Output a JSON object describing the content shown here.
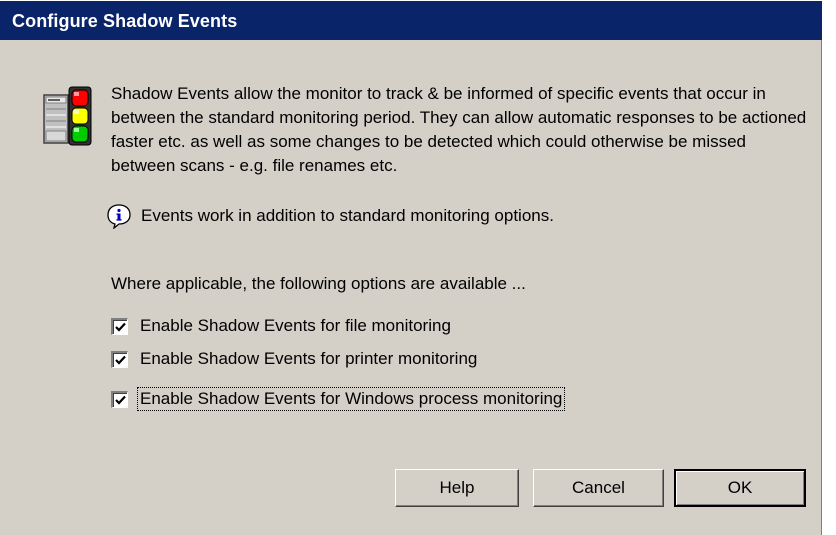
{
  "dialog": {
    "title": "Configure Shadow Events",
    "description": "Shadow Events allow the monitor to track & be informed of specific events that occur in between the standard monitoring period. They can allow automatic responses to be actioned faster etc. as well as some changes to be detected which could otherwise be missed between scans - e.g. file renames etc.",
    "info_text": "Events work in addition to standard monitoring options.",
    "options_label": "Where applicable, the following options are available ...",
    "options": [
      {
        "label": "Enable Shadow Events for file monitoring",
        "checked": true
      },
      {
        "label": "Enable Shadow Events for printer monitoring",
        "checked": true
      },
      {
        "label": "Enable Shadow Events for Windows process monitoring",
        "checked": true,
        "focused": true
      }
    ],
    "buttons": {
      "help": "Help",
      "cancel": "Cancel",
      "ok": "OK"
    }
  },
  "icons": {
    "header": "monitor-traffic-light-icon",
    "info": "info-icon",
    "check": "checkmark-icon"
  },
  "colors": {
    "titlebar": "#0a246a",
    "dialog_bg": "#d4d0c8",
    "light_red": "#ff0000",
    "light_yellow": "#ffff00",
    "light_green": "#00cc00"
  }
}
